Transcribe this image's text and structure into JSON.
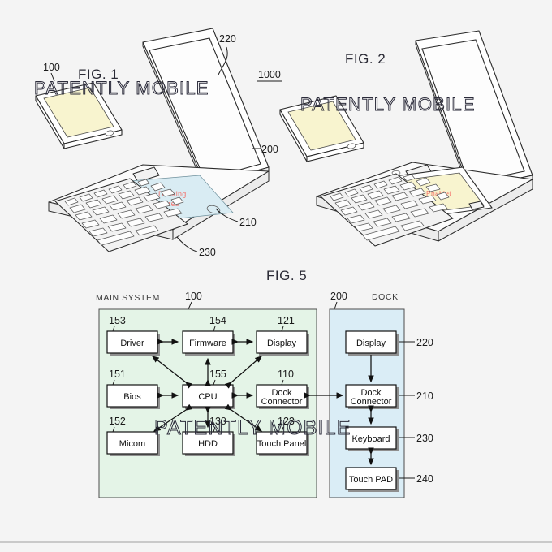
{
  "page": {
    "background": "#f4f4f4",
    "watermark_text": "PATENTLY MOBILE"
  },
  "figures": [
    {
      "id": "fig1",
      "title": "FIG. 1",
      "system_ref": "1000",
      "callouts": [
        {
          "ref": "100",
          "target": "mobile-device"
        },
        {
          "ref": "220",
          "target": "dock-display"
        },
        {
          "ref": "200",
          "target": "dock"
        },
        {
          "ref": "210",
          "target": "dock-connector"
        },
        {
          "ref": "230",
          "target": "dock-keyboard"
        }
      ],
      "annotations": [
        {
          "line1": "Docking",
          "line2": "Area",
          "color": "#f4736b"
        }
      ]
    },
    {
      "id": "fig2",
      "title": "FIG. 2",
      "annotations": [
        {
          "line1": "Phablet",
          "color": "#f4736b"
        }
      ]
    },
    {
      "id": "fig5",
      "title": "FIG. 5",
      "main_system": {
        "label": "MAIN SYSTEM",
        "ref": "100",
        "fill": "#e4f4e7",
        "blocks": [
          {
            "name": "Driver",
            "ref": "153"
          },
          {
            "name": "Firmware",
            "ref": "154"
          },
          {
            "name": "Display",
            "ref": "121"
          },
          {
            "name": "Bios",
            "ref": "151"
          },
          {
            "name": "CPU",
            "ref": "155"
          },
          {
            "name": "Dock Connector",
            "ref": "110",
            "line1": "Dock",
            "line2": "Connector"
          },
          {
            "name": "Micom",
            "ref": "152"
          },
          {
            "name": "HDD",
            "ref": "130"
          },
          {
            "name": "Touch Panel",
            "ref": "123"
          }
        ]
      },
      "dock": {
        "label": "DOCK",
        "ref": "200",
        "fill": "#daedf6",
        "blocks": [
          {
            "name": "Display",
            "ref": "220"
          },
          {
            "name": "Dock Connector",
            "ref": "210",
            "line1": "Dock",
            "line2": "Connector"
          },
          {
            "name": "Keyboard",
            "ref": "230"
          },
          {
            "name": "Touch PAD",
            "ref": "240"
          }
        ]
      }
    }
  ]
}
